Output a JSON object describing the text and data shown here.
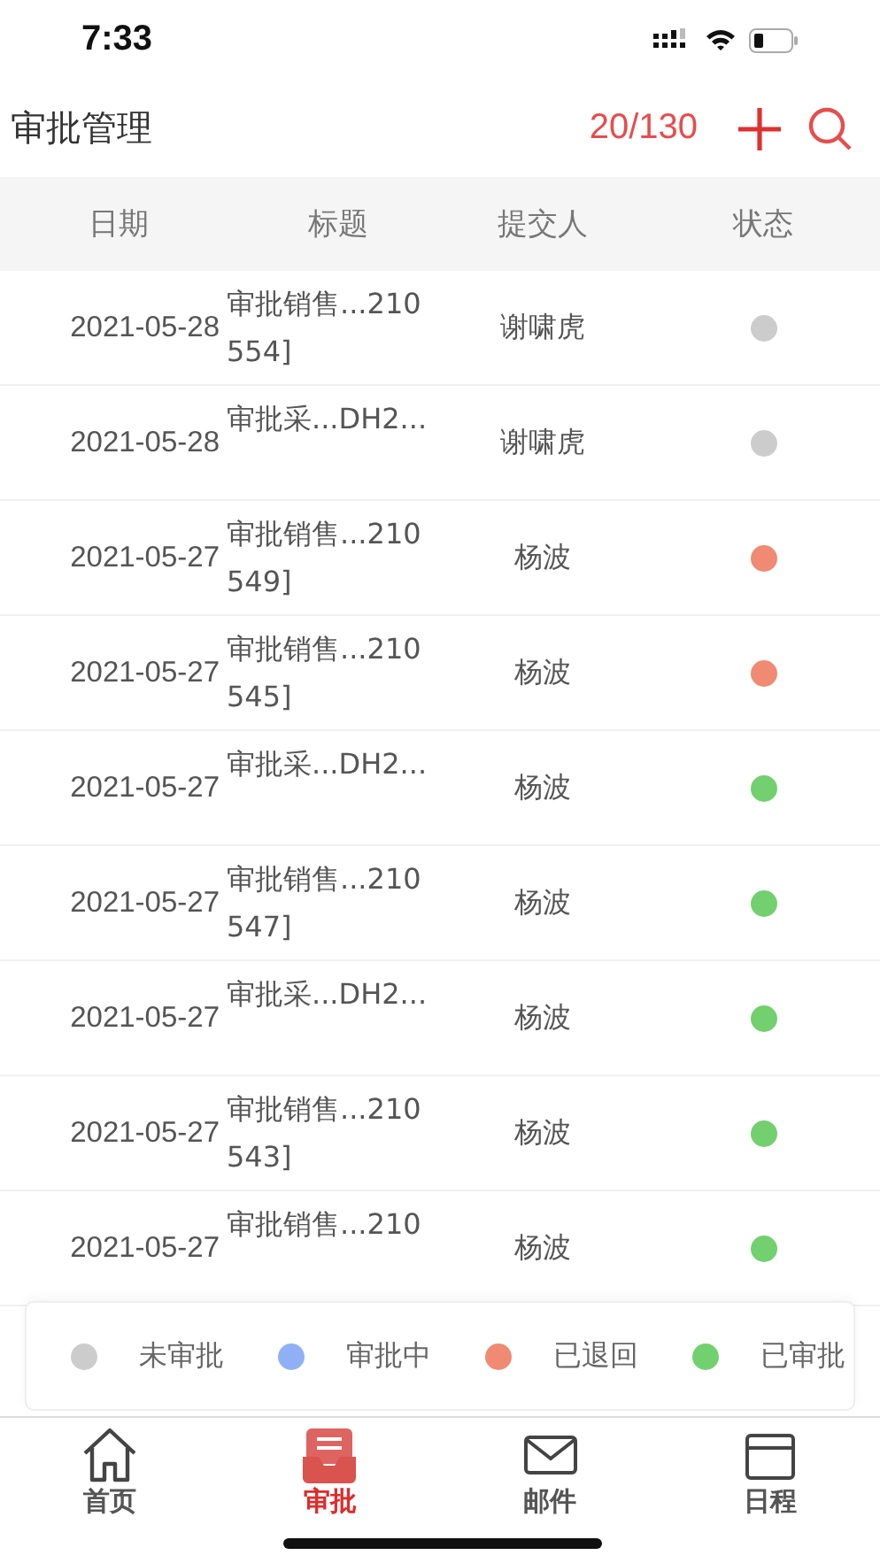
{
  "status_bar": {
    "time": "7:33"
  },
  "header": {
    "title": "审批管理",
    "count": "20/130"
  },
  "table": {
    "columns": [
      "日期",
      "标题",
      "提交人",
      "状态"
    ],
    "rows": [
      {
        "date": "2021-05-28",
        "title": "审批销售...210\n554]",
        "submitter": "谢啸虎",
        "color": "#cccccc"
      },
      {
        "date": "2021-05-28",
        "title": "审批采...DH2...",
        "submitter": "谢啸虎",
        "color": "#cccccc"
      },
      {
        "date": "2021-05-27",
        "title": "审批销售...210\n549]",
        "submitter": "杨波",
        "color": "#f08a72"
      },
      {
        "date": "2021-05-27",
        "title": "审批销售...210\n545]",
        "submitter": "杨波",
        "color": "#f08a72"
      },
      {
        "date": "2021-05-27",
        "title": "审批采...DH2...",
        "submitter": "杨波",
        "color": "#72d06e"
      },
      {
        "date": "2021-05-27",
        "title": "审批销售...210\n547]",
        "submitter": "杨波",
        "color": "#72d06e"
      },
      {
        "date": "2021-05-27",
        "title": "审批采...DH2...",
        "submitter": "杨波",
        "color": "#72d06e"
      },
      {
        "date": "2021-05-27",
        "title": "审批销售...210\n543]",
        "submitter": "杨波",
        "color": "#72d06e"
      },
      {
        "date": "2021-05-27",
        "title": "审批销售...210",
        "submitter": "杨波",
        "color": "#72d06e"
      }
    ]
  },
  "legend": [
    {
      "label": "未审批",
      "color": "#cccccc"
    },
    {
      "label": "审批中",
      "color": "#8fb0f5"
    },
    {
      "label": "已退回",
      "color": "#f08a72"
    },
    {
      "label": "已审批",
      "color": "#72d06e"
    }
  ],
  "tab_bar": [
    {
      "label": "首页",
      "kind": "home",
      "selected": false
    },
    {
      "label": "审批",
      "kind": "approval",
      "selected": true
    },
    {
      "label": "邮件",
      "kind": "mail",
      "selected": false
    },
    {
      "label": "日程",
      "kind": "calendar",
      "selected": false
    }
  ]
}
